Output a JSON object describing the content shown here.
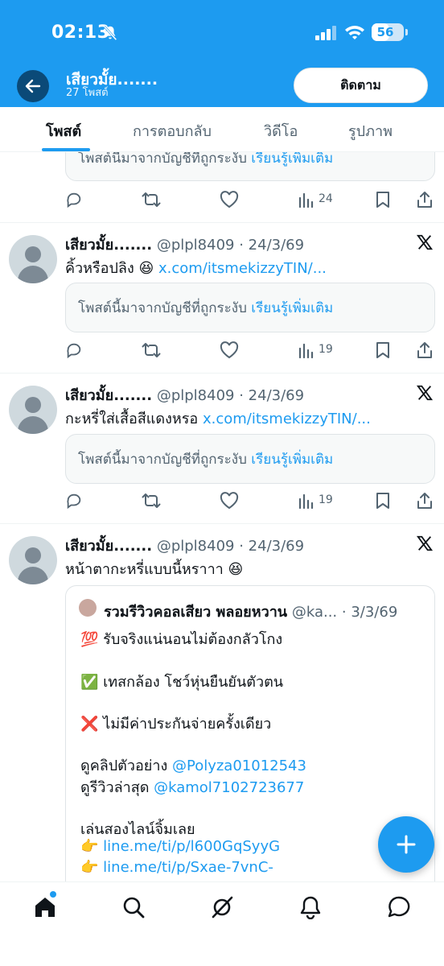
{
  "status_bar": {
    "time": "02:13",
    "battery": "56",
    "battery_percent": 56
  },
  "profile": {
    "name": "เสียวมั้ย.......",
    "post_count": "27 โพสต์",
    "follow_label": "ติดตาม"
  },
  "tabs": [
    {
      "label": "โพสต์",
      "active": true
    },
    {
      "label": "การตอบกลับ",
      "active": false
    },
    {
      "label": "วิดีโอ",
      "active": false
    },
    {
      "label": "รูปภาพ",
      "active": false
    }
  ],
  "notice": {
    "text": "โพสต์นี้มาจากบัญชีที่ถูกระงับ",
    "link": "เรียนรู้เพิ่มเติม"
  },
  "notice_partial": {
    "text": "โพสต์นี้มาจากบัญชีที่ถูกระงับ",
    "link": "เรียนรู้เพิ่มเติม"
  },
  "post0": {
    "views": "24"
  },
  "posts": [
    {
      "name": "เสียวมั้ย.......",
      "handle": "@plpl8409",
      "date": "· 24/3/69",
      "text": "คิ้วหรือปลิง",
      "emoji": "😆",
      "link": "x.com/itsmekizzyTIN/...",
      "views": "19"
    },
    {
      "name": "เสียวมั้ย.......",
      "handle": "@plpl8409",
      "date": "· 24/3/69",
      "text": "กะหรี่ใส่เสื้อสีแดงหรอ",
      "link": "x.com/itsmekizzyTIN/...",
      "views": "19"
    },
    {
      "name": "เสียวมั้ย.......",
      "handle": "@plpl8409",
      "date": "· 24/3/69",
      "text": "หน้าตากะหรี่แบบนี้หราาา",
      "emoji": "😆"
    }
  ],
  "quote": {
    "name": "รวมรีวิวคอลเสียว พลอยหวาน",
    "handle": "@ka...",
    "date": "· 3/3/69",
    "line1_emoji": "💯",
    "line1": "รับจริงแน่นอนไม่ต้องกลัวโกง",
    "line2_emoji": "✅",
    "line2": "เทสกล้อง โชว์หุ่นยืนยันตัวตน",
    "line3_emoji": "❌",
    "line3": "ไม่มีค่าประกันจ่ายครั้งเดียว",
    "clip_label": "ดูคลิปตัวอย่าง",
    "clip_handle": "@Polyza01012543",
    "review_label": "ดูรีวิวล่าสุด",
    "review_handle": "@kamol7102723677",
    "line_label": "เล่นสองไลน์จิ้มเลย",
    "point_emoji": "👉",
    "line_link1": "line.me/ti/p/l600GqSyyG",
    "line_link2": "line.me/ti/p/Sxae-7vnC-"
  },
  "icons": {
    "back": "arrow-left-icon",
    "bell": "bell-off-icon",
    "reply": "reply-icon",
    "repost": "repost-icon",
    "like": "heart-icon",
    "views": "views-icon",
    "bookmark": "bookmark-icon",
    "share": "share-icon",
    "grok": "grok-icon",
    "x_logo": "x-logo-icon",
    "compose": "plus-icon",
    "nav": [
      "home-icon",
      "search-icon",
      "grok-icon",
      "notifications-icon",
      "messages-icon"
    ]
  },
  "colors": {
    "accent": "#1d9bf0",
    "text": "#0f1419",
    "muted": "#536471"
  }
}
